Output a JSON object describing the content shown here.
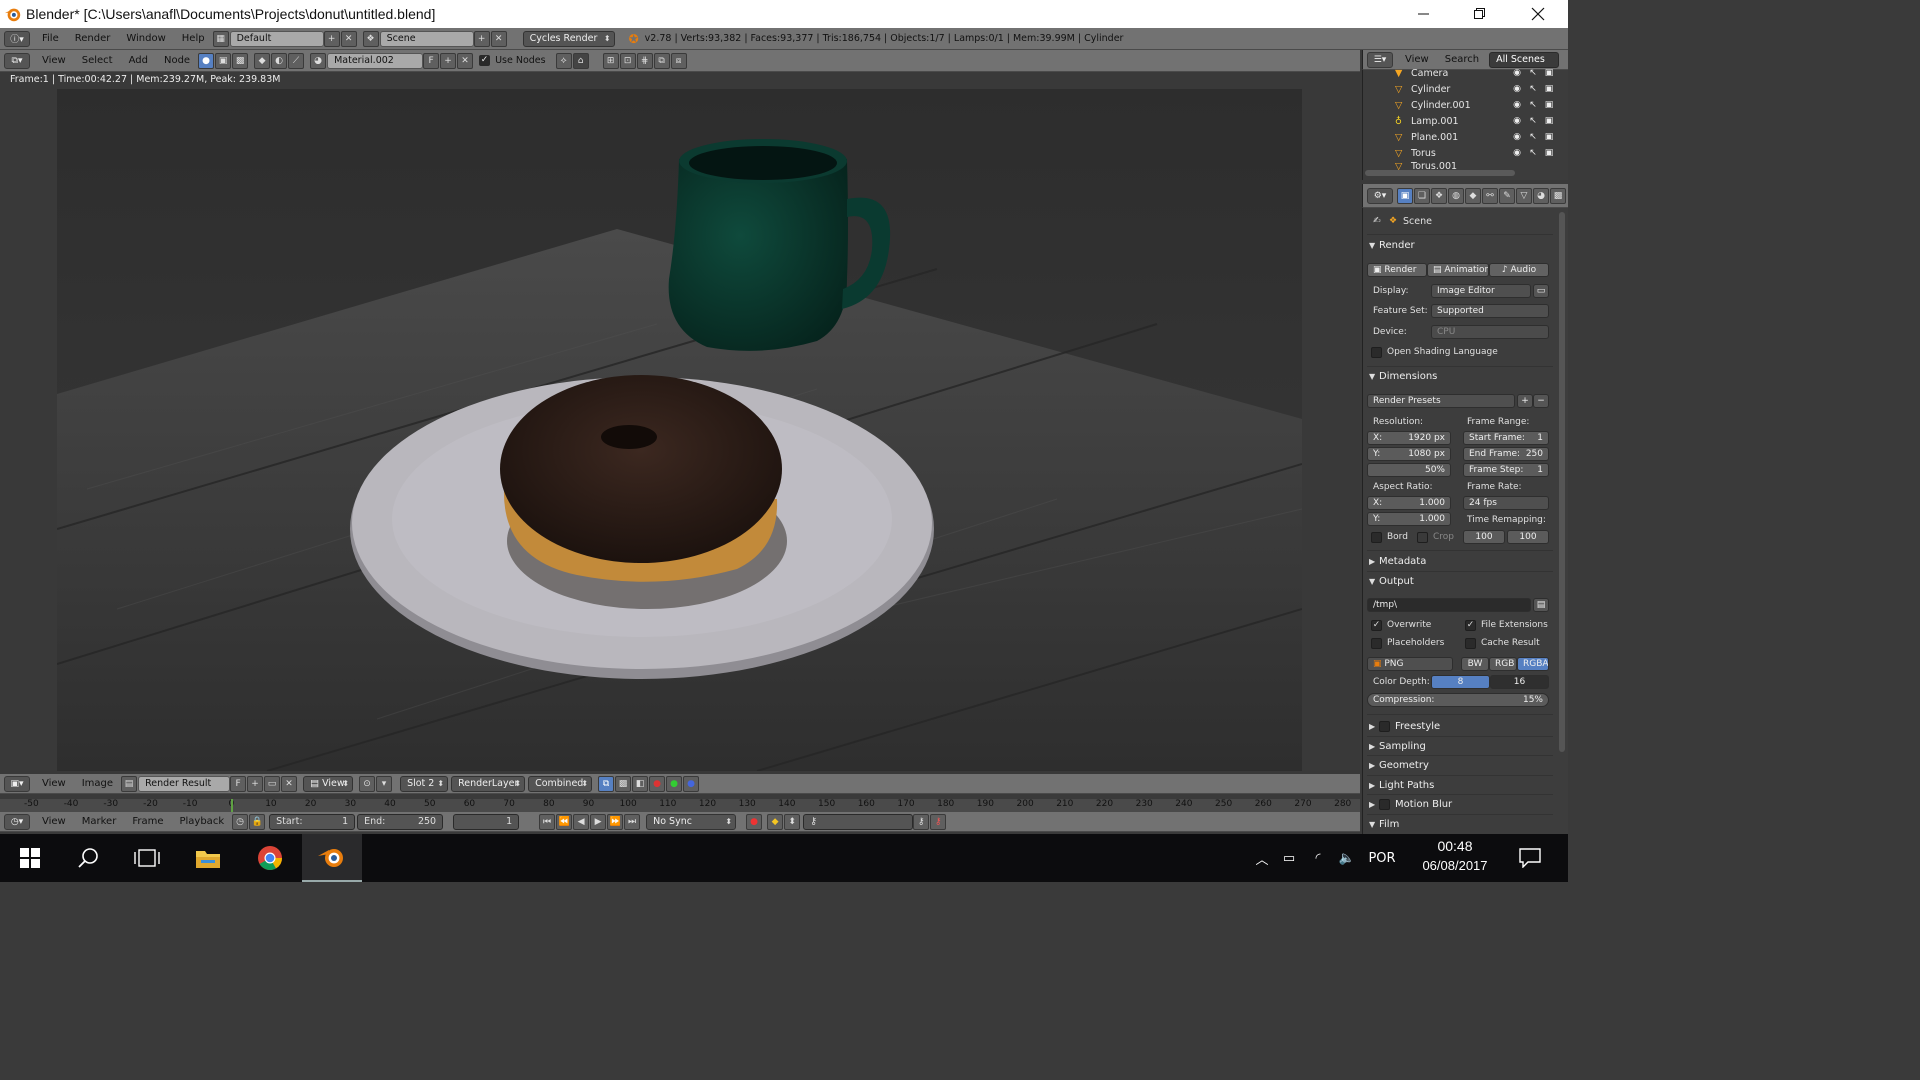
{
  "window": {
    "title": "Blender* [C:\\Users\\anafl\\Documents\\Projects\\donut\\untitled.blend]",
    "controls": [
      "minimize-icon",
      "restore-icon",
      "close-icon"
    ]
  },
  "info_header": {
    "menus": [
      "File",
      "Render",
      "Window",
      "Help"
    ],
    "layout": "Default",
    "scene": "Scene",
    "engine": "Cycles Render",
    "stats": "v2.78 | Verts:93,382 | Faces:93,377 | Tris:186,754 | Objects:1/7 | Lamps:0/1 | Mem:39.99M | Cylinder"
  },
  "node_header": {
    "menus": [
      "View",
      "Select",
      "Add",
      "Node"
    ],
    "material": "Material.002",
    "fake_user": "F",
    "use_nodes_label": "Use Nodes"
  },
  "viewport": {
    "info": "Frame:1 | Time:00:42.27 | Mem:239.27M, Peak: 239.83M"
  },
  "outliner": {
    "menus": [
      "View",
      "Search"
    ],
    "filter": "All Scenes",
    "items": [
      {
        "name": "Camera",
        "icon": "camera-icon"
      },
      {
        "name": "Cylinder",
        "icon": "mesh-icon"
      },
      {
        "name": "Cylinder.001",
        "icon": "mesh-icon"
      },
      {
        "name": "Lamp.001",
        "icon": "lamp-icon"
      },
      {
        "name": "Plane.001",
        "icon": "mesh-icon"
      },
      {
        "name": "Torus",
        "icon": "mesh-icon"
      },
      {
        "name": "Torus.001",
        "icon": "mesh-icon"
      }
    ]
  },
  "properties": {
    "context": "Scene",
    "render": {
      "header": "Render",
      "buttons": [
        "Render",
        "Animation",
        "Audio"
      ],
      "display_label": "Display:",
      "display_value": "Image Editor",
      "feature_set_label": "Feature Set:",
      "feature_set_value": "Supported",
      "device_label": "Device:",
      "device_value": "CPU",
      "osl_label": "Open Shading Language"
    },
    "dimensions": {
      "header": "Dimensions",
      "presets": "Render Presets",
      "resolution_label": "Resolution:",
      "res_x": "1920 px",
      "res_y": "1080 px",
      "res_pct": "50%",
      "frame_range_label": "Frame Range:",
      "start_frame": "Start Frame:",
      "start_frame_val": "1",
      "end_frame": "End Frame:",
      "end_frame_val": "250",
      "frame_step": "Frame Step:",
      "frame_step_val": "1",
      "aspect_label": "Aspect Ratio:",
      "aspect_x": "1.000",
      "aspect_y": "1.000",
      "frame_rate_label": "Frame Rate:",
      "frame_rate": "24 fps",
      "time_remap_label": "Time Remapping:",
      "remap_old": "100",
      "remap_new": "100",
      "x_label": "X:",
      "y_label": "Y:",
      "bord_label": "Bord",
      "crop_label": "Crop"
    },
    "metadata_header": "Metadata",
    "output": {
      "header": "Output",
      "path": "/tmp\\",
      "overwrite": "Overwrite",
      "file_extensions": "File Extensions",
      "placeholders": "Placeholders",
      "cache_result": "Cache Result",
      "format": "PNG",
      "color_modes": [
        "BW",
        "RGB",
        "RGBA"
      ],
      "color_depth_label": "Color Depth:",
      "color_depths": [
        "8",
        "16"
      ],
      "compression_label": "Compression:",
      "compression_value": "15%"
    },
    "collapsed_panels": [
      "Freestyle",
      "Sampling",
      "Geometry",
      "Light Paths",
      "Motion Blur",
      "Film"
    ]
  },
  "image_header": {
    "menus": [
      "View",
      "Image"
    ],
    "image_name": "Render Result",
    "fake_user": "F",
    "view": "View",
    "slot": "Slot 2",
    "render_layer": "RenderLayer",
    "pass": "Combined"
  },
  "timeline": {
    "ticks": [
      "-50",
      "-40",
      "-30",
      "-20",
      "-10",
      "0",
      "10",
      "20",
      "30",
      "40",
      "50",
      "60",
      "70",
      "80",
      "90",
      "100",
      "110",
      "120",
      "130",
      "140",
      "150",
      "160",
      "170",
      "180",
      "190",
      "200",
      "210",
      "220",
      "230",
      "240",
      "250",
      "260",
      "270",
      "280"
    ],
    "menus": [
      "View",
      "Marker",
      "Frame",
      "Playback"
    ],
    "start_label": "Start:",
    "start_val": "1",
    "end_label": "End:",
    "end_val": "250",
    "current": "1",
    "sync": "No Sync"
  },
  "taskbar": {
    "apps": [
      "windows-start-icon",
      "search-icon",
      "task-view-icon",
      "file-explorer-icon",
      "chrome-icon",
      "blender-icon"
    ],
    "lang": "POR",
    "time": "00:48",
    "date": "06/08/2017"
  },
  "colors": {
    "header_bg": "#727272",
    "panel_bg": "#3d3d3d",
    "accent_blue": "#5680c2",
    "blender_orange": "#e87d0d"
  }
}
